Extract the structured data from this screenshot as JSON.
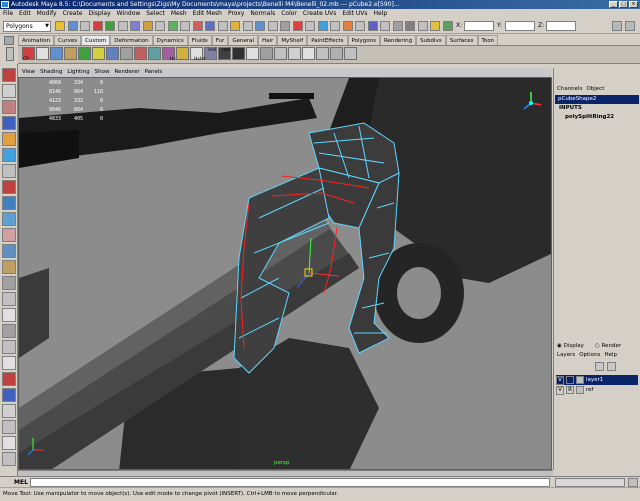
{
  "window": {
    "title": "Autodesk Maya 8.5: C:\\Documents and Settings\\Zigs\\My Documents\\maya\\projects\\Benelli M4\\Benelli_02.mb --- pCube2.e[590]..."
  },
  "menu": [
    "File",
    "Edit",
    "Modify",
    "Create",
    "Display",
    "Window",
    "Select",
    "Mesh",
    "Edit Mesh",
    "Proxy",
    "Normals",
    "Color",
    "Create UVs",
    "Edit UVs",
    "Help"
  ],
  "status_line": {
    "mode": "Polygons",
    "x_label": "X:",
    "y_label": "Y:",
    "z_label": "Z:"
  },
  "shelf_tabs": [
    "Animation",
    "Curves",
    "Custom",
    "Deformation",
    "Dynamics",
    "Fluids",
    "Fur",
    "General",
    "Hair",
    "MyShelf",
    "PaintEffects",
    "Polygons",
    "Rendering",
    "Subdivs",
    "Surfaces",
    "Toon"
  ],
  "shelf_labels": {
    "cp": "CP",
    "hs": "Hs",
    "hshd": "Hshd",
    "mel": "mel",
    "mel2": "mel"
  },
  "panel_menu": [
    "View",
    "Shading",
    "Lighting",
    "Show",
    "Renderer",
    "Panels"
  ],
  "hud": [
    [
      "4868",
      "334",
      "0"
    ],
    [
      "8146",
      "664",
      "118"
    ],
    [
      "4123",
      "332",
      "0"
    ],
    [
      "8046",
      "664",
      "0"
    ],
    [
      "4833",
      "405",
      "0"
    ]
  ],
  "viewport": {
    "camera": "persp"
  },
  "channel_box": {
    "menu": [
      "Channels",
      "Object"
    ],
    "object": "pCubeShape2",
    "inputs_label": "INPUTS",
    "input_node": "polySplitRing22"
  },
  "display_render": {
    "display": "Display",
    "render": "Render"
  },
  "layer_menu": [
    "Layers",
    "Options",
    "Help"
  ],
  "layers": [
    {
      "v": "V",
      "state": "",
      "name": "layer1"
    },
    {
      "v": "V",
      "state": "R",
      "name": "ref"
    }
  ],
  "command_line": {
    "label": "MEL"
  },
  "help_line": "Move Tool: Use manipulator to move object(s). Use edit mode to change pivot (INSERT). Ctrl+LMB to move perpendicular.",
  "colors": {
    "viewport_bg": "#8a8a8a",
    "wire_cyan": "#5fd6ff",
    "wire_red": "#ff2020",
    "title_bar": "#0a246a"
  }
}
